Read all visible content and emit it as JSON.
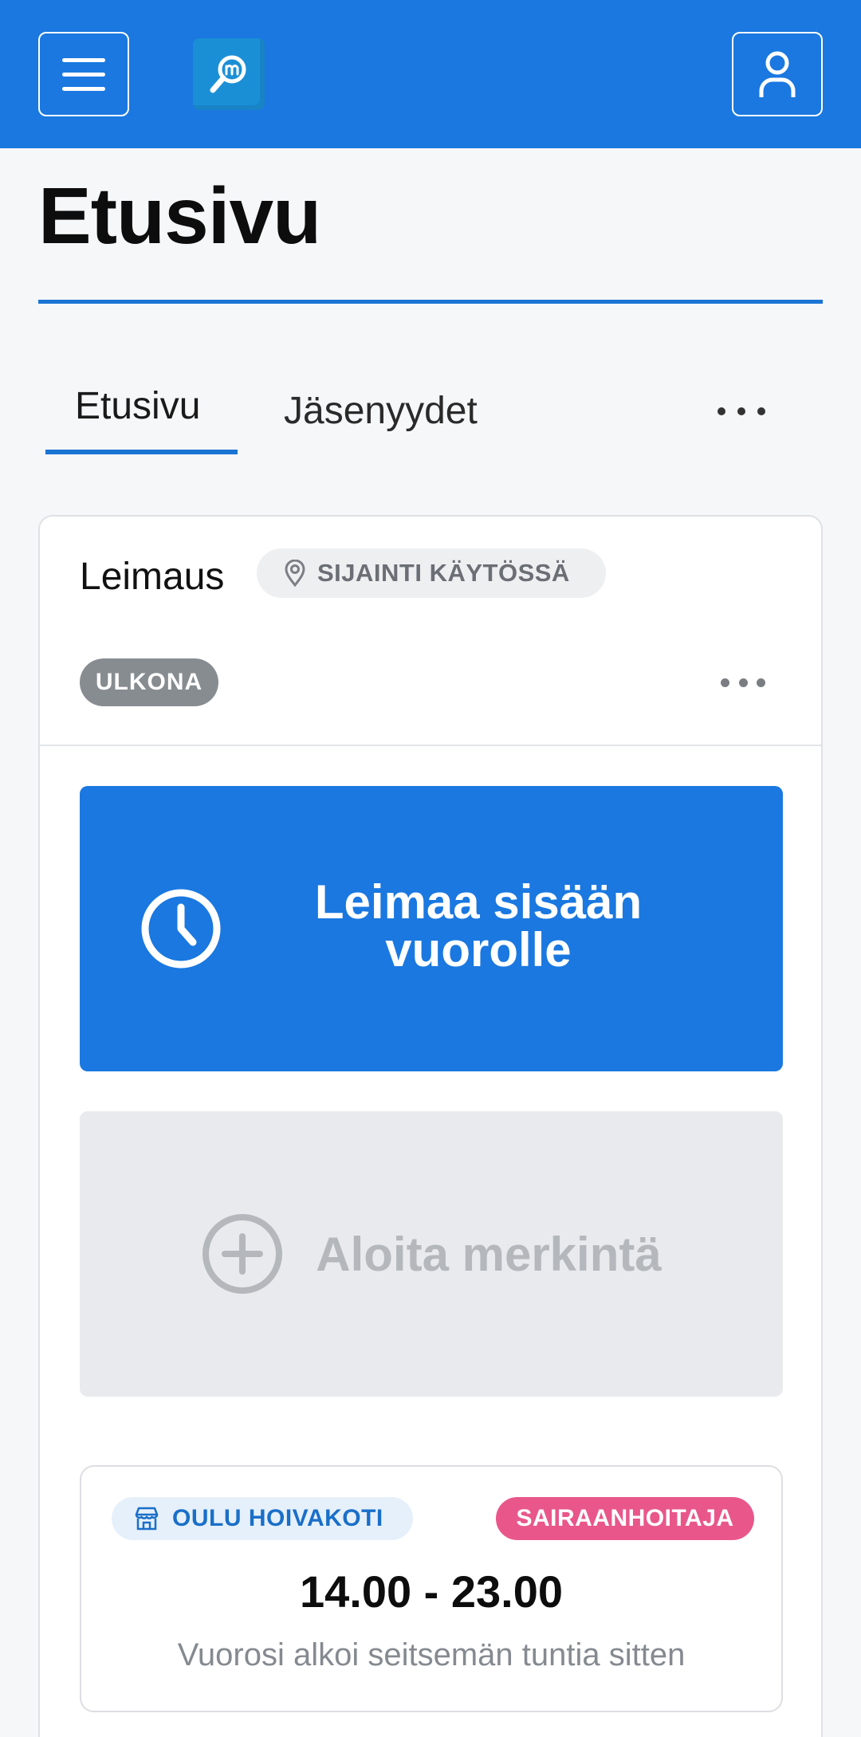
{
  "header": {
    "menu_icon": "hamburger-icon",
    "logo_icon": "app-logo-magnifier-icon",
    "user_icon": "user-icon",
    "colors": {
      "bar": "#1a78e0"
    }
  },
  "page": {
    "title": "Etusivu"
  },
  "tabs": [
    {
      "label": "Etusivu",
      "active": true
    },
    {
      "label": "Jäsenyydet",
      "active": false
    }
  ],
  "tabs_more_icon": "more-horizontal-icon",
  "stamp_card": {
    "title": "Leimaus",
    "location_badge": "SIJAINTI KÄYTÖSSÄ",
    "location_icon": "location-pin-icon",
    "status": "ULKONA",
    "more_icon": "more-horizontal-icon",
    "clock_in_button": "Leimaa sisään vuorolle",
    "clock_in_icon": "clock-icon",
    "start_entry_button": "Aloita merkintä",
    "start_entry_icon": "plus-circle-icon",
    "shift": {
      "place": "OULU HOIVAKOTI",
      "place_icon": "store-icon",
      "role": "SAIRAANHOITAJA",
      "time": "14.00 - 23.00",
      "note": "Vuorosi alkoi seitsemän tuntia sitten"
    },
    "colors": {
      "primary": "#1a78e0",
      "role_badge": "#e9578a",
      "status_badge": "#878c91"
    }
  }
}
